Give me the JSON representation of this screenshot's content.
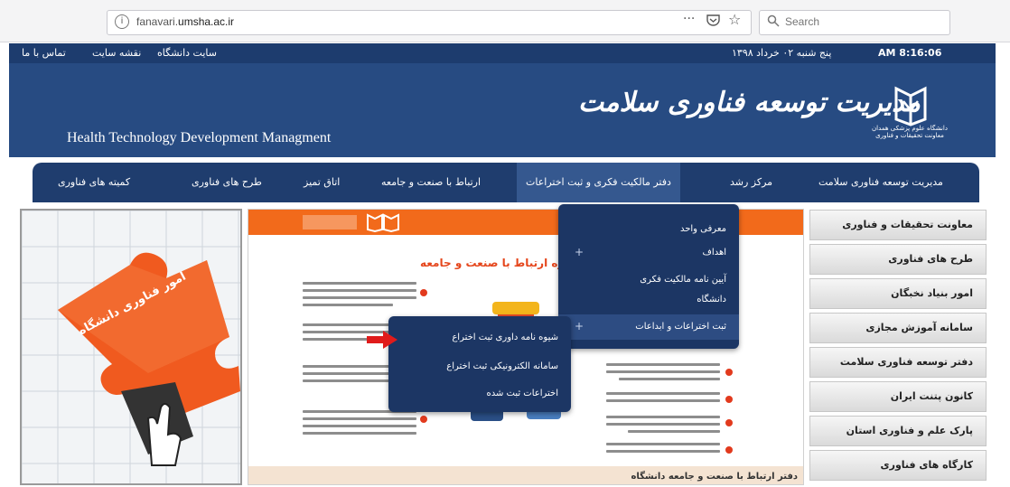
{
  "browser": {
    "url_prefix": "fanavari.",
    "url_domain": "umsha.ac.ir",
    "menu_dots": "···",
    "search_placeholder": "Search"
  },
  "topbar": {
    "time": "AM 8:16:06",
    "date": "پنج شنبه ۰۲ خرداد ۱۳۹۸",
    "links": [
      "سایت دانشگاه",
      "نقشه سایت",
      "تماس با ما"
    ]
  },
  "header": {
    "title_fa": "مدیریت توسعه فناوری سلامت",
    "title_en": "Health Technology Development Managment",
    "logo_text": "دانشگاه علوم پزشکی همدان معاونت تحقیقات و فناوری"
  },
  "nav": {
    "items": [
      "مدیریت توسعه فناوری سلامت",
      "مرکز رشد",
      "دفتر مالکیت فکری و ثبت اختراعات",
      "ارتباط با صنعت و جامعه",
      "اتاق تمیز",
      "طرح های فناوری",
      "کمیته های فناوری"
    ]
  },
  "sidebar": {
    "items": [
      "معاونت تحقیقات و فناوری",
      "طرح های فناوری",
      "امور بنیاد نخبگان",
      "سامانه آموزش مجازی",
      "دفتر توسعه فناوری سلامت",
      "کانون پتنت ایران",
      "پارک علم و فناوری استان",
      "کارگاه های فناوری"
    ]
  },
  "dropdown_main": {
    "items": [
      "معرفی واحد",
      "اهداف",
      "آیین نامه مالکیت فکری",
      "دانشگاه",
      "ثبت اختراعات و ابداعات"
    ],
    "plus": "+"
  },
  "dropdown_sub": {
    "items": [
      "شیوه نامه داوری ثبت اختراع",
      "سامانه الکترونیکی ثبت اختراع",
      "اختراعات ثبت شده"
    ]
  },
  "banner": {
    "heading": "حوزه ارتباط با صنعت و جامعه",
    "footer": "دفتر ارتباط با صنعت و جامعه دانشگاه"
  },
  "puzzle": {
    "label": "امور فناوری دانشگاه"
  },
  "colors": {
    "nav_bg": "#1f3d6e",
    "header_bg": "#274b82",
    "accent_orange": "#f26a1b",
    "arrow_red": "#e01b1b"
  }
}
